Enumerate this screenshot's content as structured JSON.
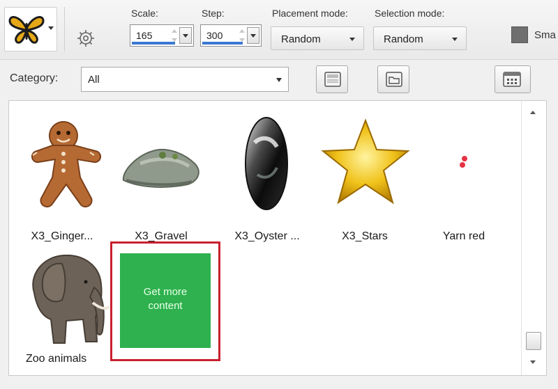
{
  "toolbar": {
    "scale": {
      "label": "Scale:",
      "value": "165"
    },
    "step": {
      "label": "Step:",
      "value": "300"
    },
    "placement_mode": {
      "label": "Placement mode:",
      "value": "Random"
    },
    "selection_mode": {
      "label": "Selection mode:",
      "value": "Random"
    },
    "smart_label": "Sma"
  },
  "category": {
    "label": "Category:",
    "value": "All"
  },
  "items": [
    {
      "label": "X3_Ginger...",
      "icon": "gingerbread-man-icon"
    },
    {
      "label": "X3_Gravel",
      "icon": "gravel-rock-icon"
    },
    {
      "label": "X3_Oyster ...",
      "icon": "oyster-shell-icon"
    },
    {
      "label": "X3_Stars",
      "icon": "gold-star-icon"
    },
    {
      "label": "Yarn red",
      "icon": "yarn-red-icon"
    },
    {
      "label": "Zoo animals",
      "icon": "elephant-icon"
    }
  ],
  "get_more": {
    "line1": "Get more",
    "line2": "content"
  },
  "colors": {
    "accent": "#3a78d1",
    "get_more_bg": "#2eb14e",
    "highlight": "#c8202f"
  }
}
